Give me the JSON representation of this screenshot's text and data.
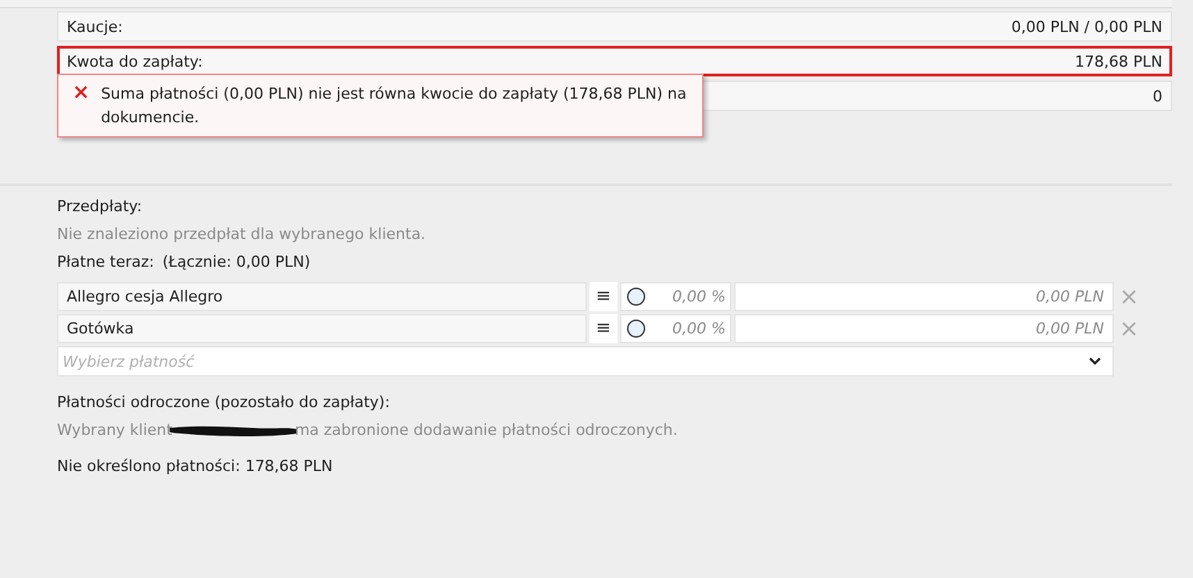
{
  "summary_rows": [
    {
      "label": "Kaucje:",
      "value": "0,00 PLN / 0,00 PLN",
      "error": false
    },
    {
      "label": "Kwota do zapłaty:",
      "value": "178,68 PLN",
      "error": true
    },
    {
      "value": "0",
      "error": false
    }
  ],
  "error_tooltip": {
    "icon": "×",
    "message": "Suma płatności (0,00 PLN) nie jest równa kwocie do zapłaty (178,68 PLN) na dokumencie."
  },
  "prepayments": {
    "title": "Przedpłaty:",
    "note": "Nie znaleziono przedpłat dla wybranego klienta."
  },
  "paid_now": {
    "title": "Płatne teraz:",
    "total": "(Łącznie: 0,00 PLN)",
    "payments": [
      {
        "name": "Allegro cesja Allegro",
        "menu_icon": "≡",
        "percent": "0,00 %",
        "amount": "0,00 PLN",
        "remove": "×",
        "selected": false
      },
      {
        "name": "Gotówka",
        "menu_icon": "≡",
        "percent": "0,00 %",
        "amount": "0,00 PLN",
        "remove": "×",
        "selected": false
      }
    ],
    "picker": {
      "placeholder": "Wybierz płatność"
    }
  },
  "deferred": {
    "title": "Płatności odroczone (pozostało do zapłaty):",
    "note_before": "Wybrany klient",
    "note_after": "ma zabronione dodawanie płatności odroczonych."
  },
  "unassigned": "Nie określono płatności: 178,68 PLN"
}
